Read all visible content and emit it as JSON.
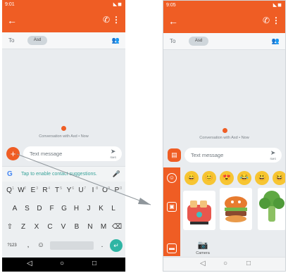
{
  "status": {
    "left_time": "9:01",
    "right_time": "9:05",
    "signal_icons": "◣◼"
  },
  "appbar": {
    "back_glyph": "←",
    "call_glyph": "✆",
    "more_glyph": "⋮"
  },
  "recipient": {
    "to_label": "To",
    "name": "Asd",
    "add_people_glyph": "👥"
  },
  "conversation": {
    "note": "Conversation with Asd • Now"
  },
  "compose": {
    "placeholder": "Text message",
    "send_glyph": "➤",
    "sms_label": "SMS"
  },
  "suggestions": {
    "google_glyph": "G",
    "hint": "Tap to enable contact suggestions.",
    "mic_glyph": "🎤"
  },
  "keyboard": {
    "row1": [
      {
        "k": "Q",
        "n": "1"
      },
      {
        "k": "W",
        "n": "2"
      },
      {
        "k": "E",
        "n": "3"
      },
      {
        "k": "R",
        "n": "4"
      },
      {
        "k": "T",
        "n": "5"
      },
      {
        "k": "Y",
        "n": "6"
      },
      {
        "k": "U",
        "n": "7"
      },
      {
        "k": "I",
        "n": "8"
      },
      {
        "k": "O",
        "n": "9"
      },
      {
        "k": "P",
        "n": "0"
      }
    ],
    "row2": [
      "A",
      "S",
      "D",
      "F",
      "G",
      "H",
      "J",
      "K",
      "L"
    ],
    "row3": [
      "⇧",
      "Z",
      "X",
      "C",
      "V",
      "B",
      "N",
      "M",
      "⌫"
    ],
    "row4": [
      "?123",
      ",",
      "☺",
      "",
      ".",
      "↵"
    ]
  },
  "nav": {
    "back": "◁",
    "home": "○",
    "recents": "□"
  },
  "emoji_panel": {
    "category_glyphs": [
      "☺",
      "▣",
      "▬"
    ],
    "emojis": [
      "😄",
      "😊",
      "😍",
      "😂",
      "😃",
      "😆"
    ],
    "camera_glyph": "📷",
    "camera_label": "Camera"
  },
  "colors": {
    "accent": "#ef5d24",
    "hint": "#3aa39a",
    "google_blue": "#4285f4"
  }
}
